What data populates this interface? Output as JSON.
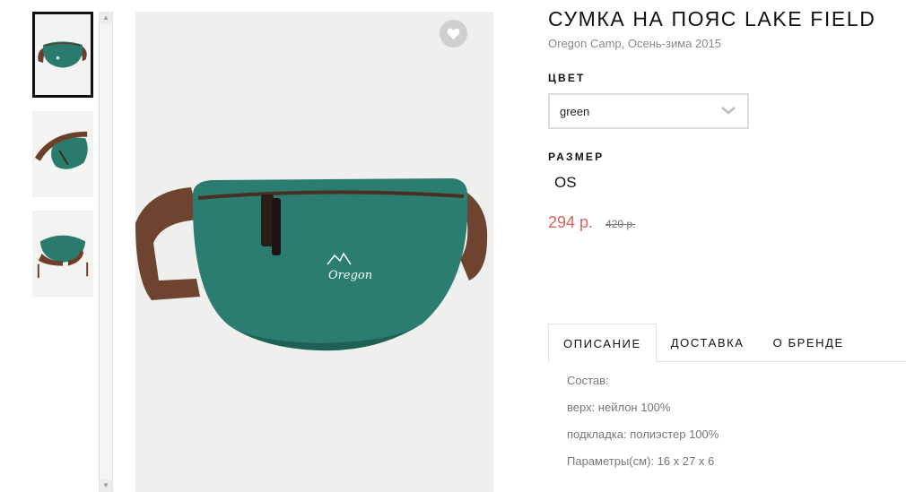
{
  "gallery": {
    "thumbnails": [
      "front view",
      "angled view",
      "back view"
    ],
    "favorite_icon": "heart-icon"
  },
  "product": {
    "title": "СУМКА НА ПОЯС LAKE FIELD",
    "subtitle": "Oregon Camp, Осень-зима 2015",
    "color_label": "ЦВЕТ",
    "color_value": "green",
    "size_label": "РАЗМЕР",
    "size_value": "OS",
    "price": "294 р.",
    "old_price": "420 р.",
    "accent_color": "#d9655a"
  },
  "tabs": [
    {
      "label": "ОПИСАНИЕ",
      "active": true
    },
    {
      "label": "ДОСТАВКА",
      "active": false
    },
    {
      "label": "О БРЕНДЕ",
      "active": false
    }
  ],
  "description": [
    "Состав:",
    "верх: нейлон 100%",
    "подкладка: полиэстер 100%",
    "Параметры(см): 16 х 27 х 6"
  ]
}
